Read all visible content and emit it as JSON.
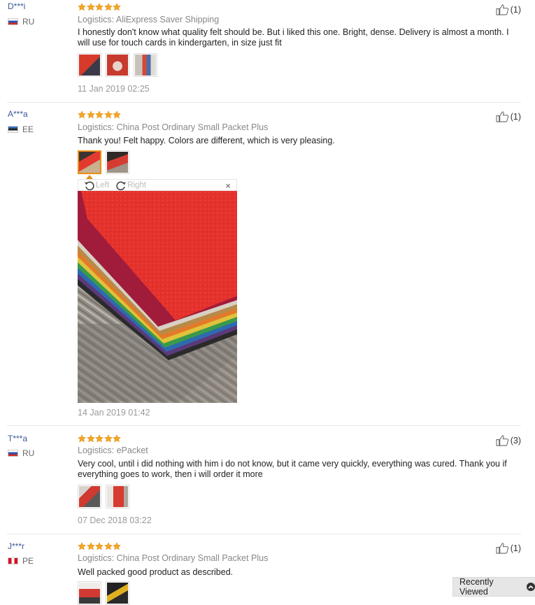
{
  "reviews": [
    {
      "user": "D***i",
      "country": "RU",
      "logistics": "Logistics: AliExpress Saver Shipping",
      "text": "I honestly don't know what quality felt should be. But i liked this one. Bright, dense. Delivery is almost a month. I will use for touch cards in kindergarten, in size just fit",
      "date": "11 Jan 2019 02:25",
      "helpful": "(1)",
      "rating": 5
    },
    {
      "user": "A***a",
      "country": "EE",
      "logistics": "Logistics: China Post Ordinary Small Packet Plus",
      "text": "Thank you! Felt happy. Colors are different, which is very pleasing.",
      "date": "14 Jan 2019 01:42",
      "helpful": "(1)",
      "rating": 5
    },
    {
      "user": "T***a",
      "country": "RU",
      "logistics": "Logistics: ePacket",
      "text": "Very cool, until i did nothing with him i do not know, but it came very quickly, everything was cured. Thank you if everything goes to work, then i will order it more",
      "date": "07 Dec 2018 03:22",
      "helpful": "(3)",
      "rating": 5
    },
    {
      "user": "J***r",
      "country": "PE",
      "logistics": "Logistics: China Post Ordinary Small Packet Plus",
      "text": "Well packed good product as described.",
      "helpful": "(1)",
      "rating": 5
    }
  ],
  "viewer": {
    "rotate_left": "Left",
    "rotate_right": "Right",
    "close": "×"
  },
  "recently_viewed": "Recently Viewed",
  "colors": {
    "star": "#f5a623",
    "accent": "#e88e16",
    "username": "#3a5998"
  },
  "icons": [
    "star-icon",
    "thumbs-up-icon",
    "rotate-left-icon",
    "rotate-right-icon",
    "close-icon",
    "chevron-up-icon"
  ]
}
